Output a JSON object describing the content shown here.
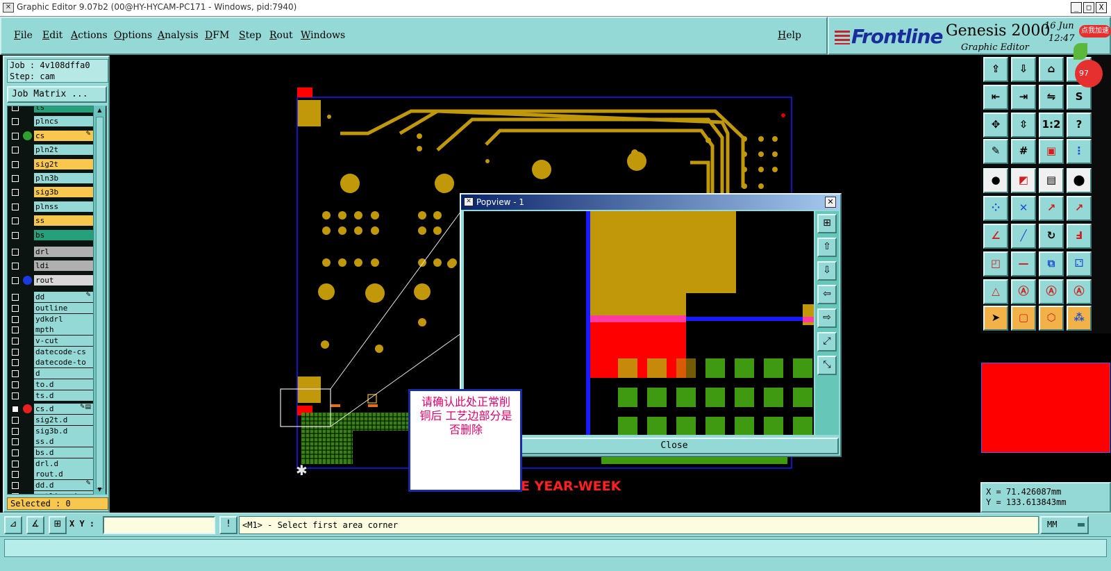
{
  "window": {
    "title": "Graphic Editor 9.07b2 (00@HY-HYCAM-PC171 - Windows, pid:7940)",
    "controls": [
      "_",
      "□",
      "X"
    ]
  },
  "menu": [
    "File",
    "Edit",
    "Actions",
    "Options",
    "Analysis",
    "DFM",
    "Step",
    "Rout",
    "Windows"
  ],
  "help_label": "Help",
  "brand": {
    "logo": "Frontline",
    "product": "Genesis 2000",
    "subtitle": "Graphic Editor",
    "date": "16 Jun",
    "time": "12:47",
    "accelerator_badge": "点我加速",
    "counter_badge": "97"
  },
  "job": {
    "job_line": "Job : 4v108dffa0",
    "step_line": "Step: cam",
    "matrix_button": "Job Matrix ..."
  },
  "layers": [
    {
      "name": "ts",
      "color": "#26a07a",
      "dot": "",
      "mark": ""
    },
    {
      "name": "plncs",
      "color": "#94d9d6",
      "dot": "",
      "mark": ""
    },
    {
      "name": "cs",
      "color": "#f8c84e",
      "dot": "#2fa02f",
      "mark": "✎"
    },
    {
      "name": "pln2t",
      "color": "#94d9d6",
      "dot": "",
      "mark": ""
    },
    {
      "name": "sig2t",
      "color": "#f8c84e",
      "dot": "",
      "mark": ""
    },
    {
      "name": "pln3b",
      "color": "#94d9d6",
      "dot": "",
      "mark": ""
    },
    {
      "name": "sig3b",
      "color": "#f8c84e",
      "dot": "",
      "mark": ""
    },
    {
      "name": "plnss",
      "color": "#94d9d6",
      "dot": "",
      "mark": ""
    },
    {
      "name": "ss",
      "color": "#f8c84e",
      "dot": "",
      "mark": ""
    },
    {
      "name": "bs",
      "color": "#26a07a",
      "dot": "",
      "mark": ""
    },
    {
      "name": "drl",
      "color": "#b0b0b0",
      "dot": "",
      "mark": ""
    },
    {
      "name": "ldi",
      "color": "#b0b0b0",
      "dot": "",
      "mark": ""
    },
    {
      "name": "rout",
      "color": "#d8d8d8",
      "dot": "#1a3adf",
      "mark": ""
    },
    {
      "name": "dd",
      "color": "#94d9d6",
      "dot": "",
      "mark": "✎"
    },
    {
      "name": "outline",
      "color": "#94d9d6",
      "dot": "",
      "mark": ""
    },
    {
      "name": "ydkdrl",
      "color": "#94d9d6",
      "dot": "",
      "mark": ""
    },
    {
      "name": "mpth",
      "color": "#94d9d6",
      "dot": "",
      "mark": ""
    },
    {
      "name": "v-cut",
      "color": "#94d9d6",
      "dot": "",
      "mark": ""
    },
    {
      "name": "datecode-cs",
      "color": "#94d9d6",
      "dot": "",
      "mark": ""
    },
    {
      "name": "datecode-to",
      "color": "#94d9d6",
      "dot": "",
      "mark": ""
    },
    {
      "name": "d",
      "color": "#94d9d6",
      "dot": "",
      "mark": ""
    },
    {
      "name": "to.d",
      "color": "#94d9d6",
      "dot": "",
      "mark": ""
    },
    {
      "name": "ts.d",
      "color": "#94d9d6",
      "dot": "",
      "mark": ""
    },
    {
      "name": "cs.d",
      "color": "#94d9d6",
      "dot": "#e82020",
      "mark": "✎▤",
      "checked": true
    },
    {
      "name": "sig2t.d",
      "color": "#94d9d6",
      "dot": "",
      "mark": ""
    },
    {
      "name": "sig3b.d",
      "color": "#94d9d6",
      "dot": "",
      "mark": ""
    },
    {
      "name": "ss.d",
      "color": "#94d9d6",
      "dot": "",
      "mark": ""
    },
    {
      "name": "bs.d",
      "color": "#94d9d6",
      "dot": "",
      "mark": ""
    },
    {
      "name": "drl.d",
      "color": "#94d9d6",
      "dot": "",
      "mark": ""
    },
    {
      "name": "rout.d",
      "color": "#94d9d6",
      "dot": "",
      "mark": ""
    },
    {
      "name": "dd.d",
      "color": "#94d9d6",
      "dot": "",
      "mark": "✎"
    },
    {
      "name": "outline.d",
      "color": "#94d9d6",
      "dot": "",
      "mark": ""
    }
  ],
  "selected": "Selected : 0",
  "canvas": {
    "datecode_text": "E YEAR-WEEK",
    "marker_glyph": "✱"
  },
  "popview": {
    "title": "Popview - 1",
    "close_button": "Close"
  },
  "annotation": "请确认此处正常削铜后  工艺边部分是否删除",
  "coords": {
    "x": "X = 71.426087mm",
    "y": "Y = 133.613843mm"
  },
  "status": {
    "xy_label": "X Y :",
    "xy_value": "",
    "message": "<M1> - Select first area corner",
    "units": "MM"
  },
  "colors": {
    "panel": "#94d9d6",
    "copper": "#c0980a",
    "profile_blue": "#1a1aff",
    "highlight_red": "#ff0000",
    "pad_green": "#3f9a12"
  }
}
